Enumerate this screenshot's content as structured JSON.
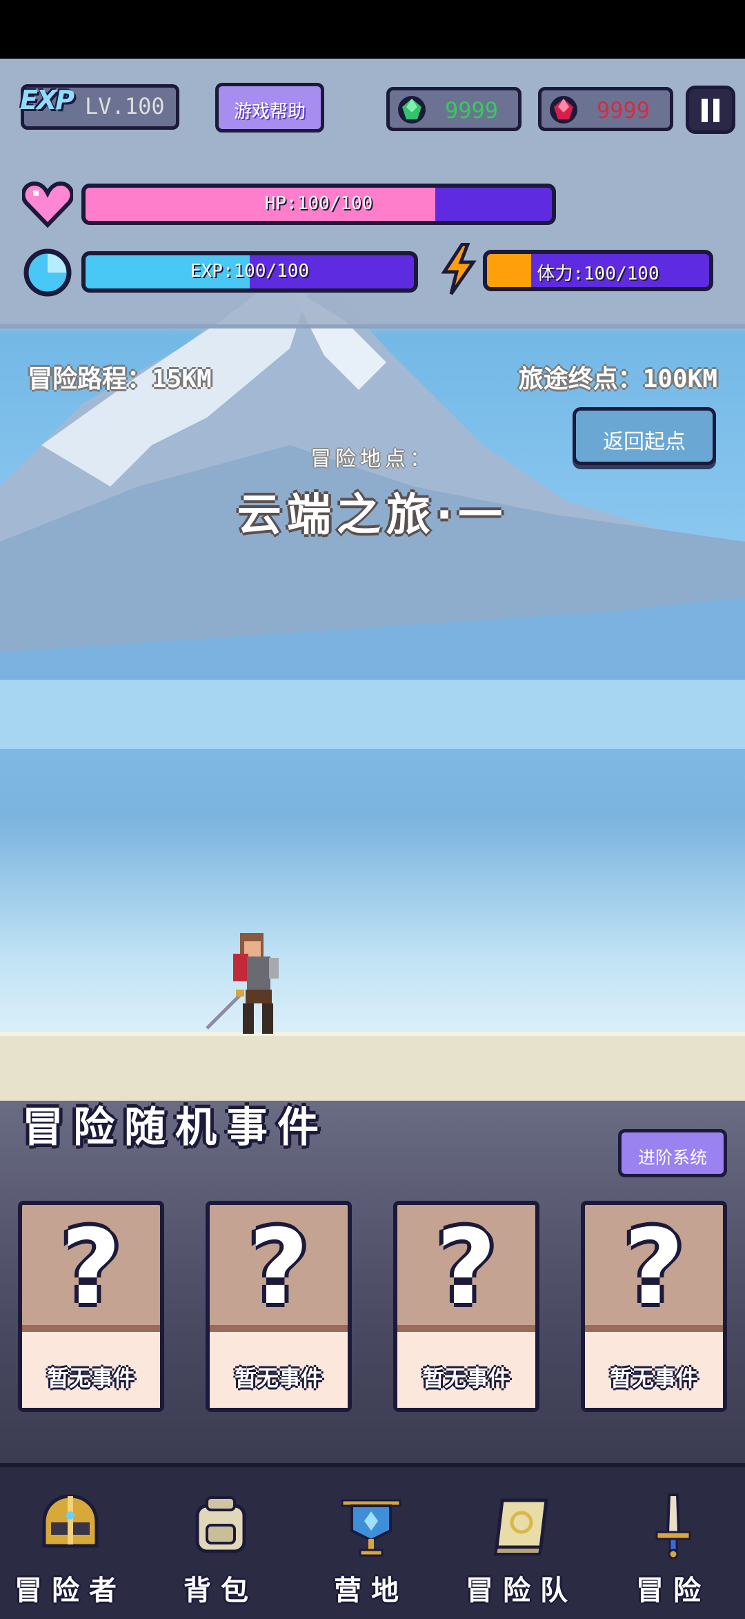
{
  "header": {
    "exp_logo": "EXP",
    "level": "LV.100",
    "help_button": "游戏帮助",
    "green_gems": "9999",
    "red_gems": "9999"
  },
  "stats": {
    "hp": {
      "label": "HP:100/100",
      "fraction": 0.75
    },
    "exp": {
      "label": "EXP:100/100",
      "fraction": 0.5
    },
    "stamina": {
      "label": "体力:100/100",
      "fraction": 0.2
    }
  },
  "journey": {
    "progress": "冒险路程：15KM",
    "destination": "旅途终点：100KM",
    "return_button": "返回起点",
    "location_label": "冒险地点：",
    "location_name": "云端之旅·一"
  },
  "events": {
    "title": "冒险随机事件",
    "advance_button": "进阶系统",
    "cards": [
      {
        "label": "暂无事件"
      },
      {
        "label": "暂无事件"
      },
      {
        "label": "暂无事件"
      },
      {
        "label": "暂无事件"
      }
    ]
  },
  "nav": {
    "items": [
      {
        "label": "冒险者",
        "icon": "helmet-icon"
      },
      {
        "label": "背包",
        "icon": "backpack-icon"
      },
      {
        "label": "营地",
        "icon": "banner-icon"
      },
      {
        "label": "冒险队",
        "icon": "book-icon"
      },
      {
        "label": "冒险",
        "icon": "sword-icon"
      }
    ]
  },
  "colors": {
    "hp_fill": "#ff7ecb",
    "exp_fill": "#49c7f5",
    "stamina_fill": "#ff9f0a",
    "bar_track": "#5e2be0",
    "outline": "#1c1a3a"
  }
}
